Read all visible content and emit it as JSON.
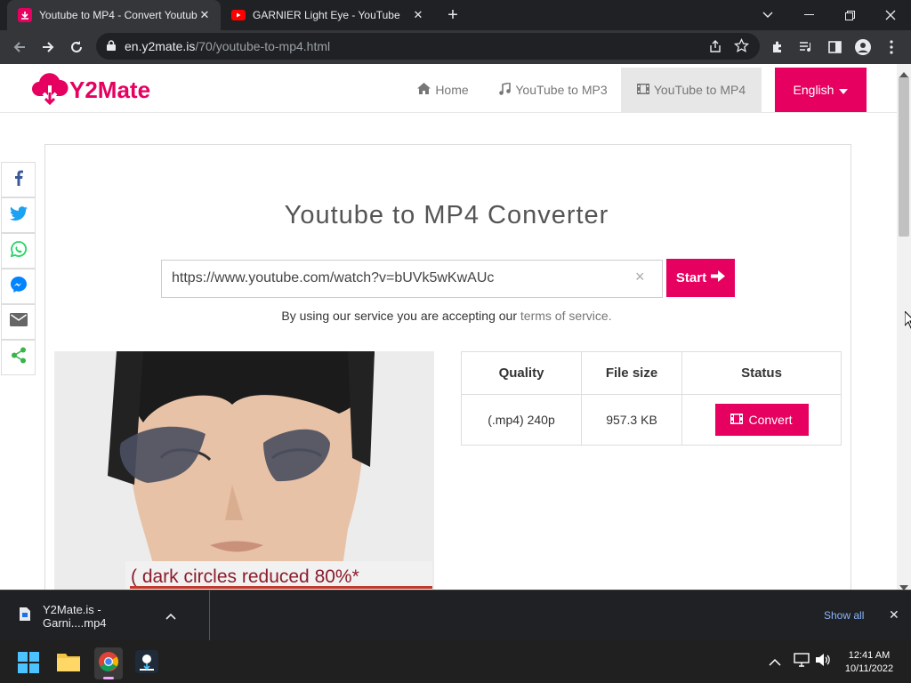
{
  "browser": {
    "tabs": [
      {
        "title": "Youtube to MP4 - Convert Youtube",
        "close": "✕",
        "favicon": "y2mate-download-icon"
      },
      {
        "title": "GARNIER Light Eye - YouTube",
        "close": "✕",
        "favicon": "youtube-icon"
      }
    ],
    "new_tab": "+",
    "url_domain": "en.y2mate.is",
    "url_path": "/70/youtube-to-mp4.html"
  },
  "site": {
    "logo": "Y2Mate",
    "nav": [
      {
        "label": "Home",
        "icon": "home-icon"
      },
      {
        "label": "YouTube to MP3",
        "icon": "music-icon"
      },
      {
        "label": "YouTube to MP4",
        "icon": "film-icon"
      }
    ],
    "language": "English",
    "accent": "#e60060"
  },
  "share": [
    "facebook-icon",
    "twitter-icon",
    "whatsapp-icon",
    "messenger-icon",
    "email-icon",
    "share-icon"
  ],
  "main": {
    "heading": "Youtube to MP4 Converter",
    "url_value": "https://www.youtube.com/watch?v=bUVk5wKwAUc",
    "clear": "×",
    "start_label": "Start",
    "terms_prefix": "By using our service you are accepting our",
    "terms_link": "terms of service.",
    "thumbnail_caption": "( dark circles reduced 80%*",
    "table": {
      "headers": [
        "Quality",
        "File size",
        "Status"
      ],
      "rows": [
        {
          "quality": "(.mp4) 240p",
          "size": "957.3 KB",
          "action": "Convert"
        }
      ]
    }
  },
  "downloads": {
    "file": "Y2Mate.is - Garni....mp4",
    "show_all": "Show all",
    "close": "✕"
  },
  "taskbar": {
    "time": "12:41 AM",
    "date": "10/11/2022"
  }
}
